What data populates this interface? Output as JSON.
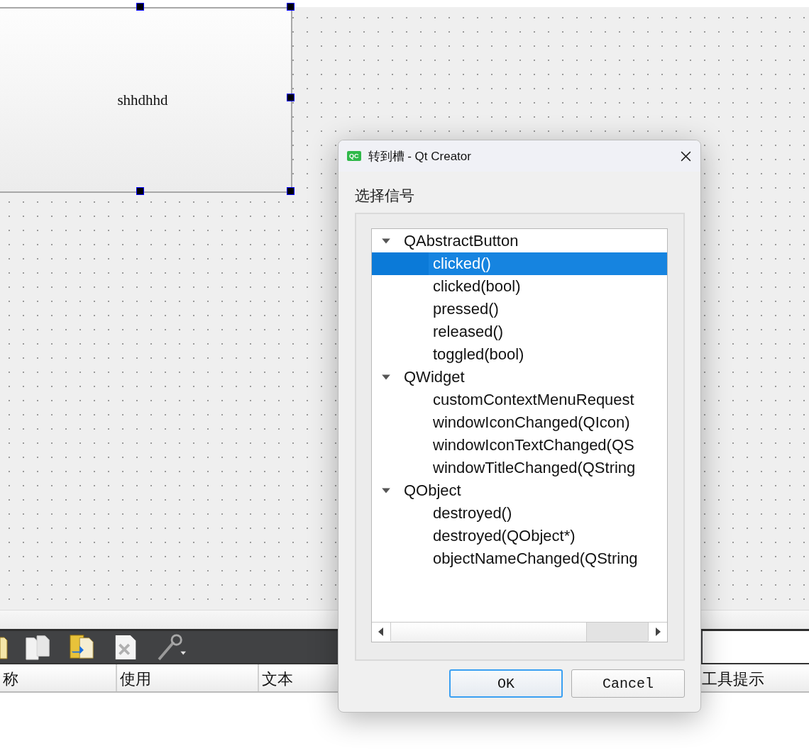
{
  "form": {
    "widget": {
      "text": "shhdhhd",
      "selected": true
    }
  },
  "toolbar": {
    "items": [
      {
        "kind": "folder"
      },
      {
        "kind": "pages"
      },
      {
        "kind": "copy"
      },
      {
        "kind": "delete"
      },
      {
        "kind": "wrench"
      }
    ]
  },
  "table": {
    "columns": [
      "称",
      "使用",
      "文本",
      "工具提示"
    ]
  },
  "dialog": {
    "app_icon_label": "QC",
    "title": "转到槽 - Qt Creator",
    "label": "选择信号",
    "tree": [
      {
        "label": "QAbstractButton",
        "expanded": true,
        "selected": false,
        "children": [
          {
            "label": "clicked()",
            "selected": true
          },
          {
            "label": "clicked(bool)",
            "selected": false
          },
          {
            "label": "pressed()",
            "selected": false
          },
          {
            "label": "released()",
            "selected": false
          },
          {
            "label": "toggled(bool)",
            "selected": false
          }
        ]
      },
      {
        "label": "QWidget",
        "expanded": true,
        "selected": false,
        "children": [
          {
            "label": "customContextMenuRequest",
            "selected": false
          },
          {
            "label": "windowIconChanged(QIcon)",
            "selected": false
          },
          {
            "label": "windowIconTextChanged(QS",
            "selected": false
          },
          {
            "label": "windowTitleChanged(QString",
            "selected": false
          }
        ]
      },
      {
        "label": "QObject",
        "expanded": true,
        "selected": false,
        "children": [
          {
            "label": "destroyed()",
            "selected": false
          },
          {
            "label": "destroyed(QObject*)",
            "selected": false
          },
          {
            "label": "objectNameChanged(QString",
            "selected": false
          }
        ]
      }
    ],
    "buttons": [
      {
        "label": "OK",
        "default": true
      },
      {
        "label": "Cancel",
        "default": false
      }
    ]
  }
}
